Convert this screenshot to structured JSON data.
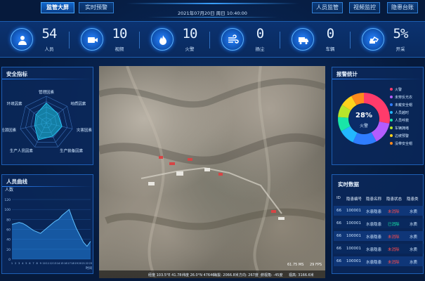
{
  "header": {
    "left_tabs": [
      {
        "label": "监管大屏",
        "active": true
      },
      {
        "label": "实时预警",
        "active": false
      }
    ],
    "datetime": "2021年07月20日  周日  10:40:00",
    "right_tabs": [
      {
        "label": "人员监管"
      },
      {
        "label": "视频监控"
      },
      {
        "label": "隐患台账"
      }
    ]
  },
  "stats": [
    {
      "value": "54",
      "label": "人员",
      "icon": "person-icon"
    },
    {
      "value": "10",
      "label": "视频",
      "icon": "video-icon"
    },
    {
      "value": "10",
      "label": "火警",
      "icon": "fire-icon"
    },
    {
      "value": "0",
      "label": "扬尘",
      "icon": "wind-icon"
    },
    {
      "value": "0",
      "label": "车辆",
      "icon": "truck-icon"
    },
    {
      "value": "5%",
      "label": "开采",
      "icon": "excavator-icon"
    }
  ],
  "safety_panel": {
    "title": "安全指标",
    "axes": [
      "管理因素",
      "地质因素",
      "灾害因素",
      "生产装备因素",
      "生产人员因素",
      "危险源因素",
      "环境因素"
    ],
    "radar_values": [
      0.75,
      0.55,
      0.6,
      0.55,
      0.7,
      0.45,
      0.5
    ]
  },
  "personnel_panel": {
    "title": "人员曲线",
    "unit": "人数",
    "x_unit": "时间",
    "y_ticks": [
      "120",
      "100",
      "80",
      "60",
      "40",
      "20",
      "0"
    ]
  },
  "chart_data": {
    "type": "area",
    "title": "人员曲线",
    "ylabel": "人数",
    "xlabel": "时间",
    "x": [
      "1",
      "2",
      "3",
      "4",
      "5",
      "6",
      "7",
      "8",
      "9",
      "10",
      "11",
      "12",
      "13",
      "14",
      "15",
      "16",
      "17",
      "18",
      "19",
      "20",
      "21",
      "22",
      "23"
    ],
    "values": [
      70,
      72,
      74,
      72,
      68,
      63,
      58,
      55,
      52,
      58,
      64,
      70,
      76,
      80,
      88,
      94,
      100,
      80,
      62,
      48,
      34,
      26,
      36
    ],
    "ylim": [
      0,
      120
    ]
  },
  "alarm_panel": {
    "title": "报警统计",
    "center_value": "28%",
    "center_label": "火警",
    "legend": [
      {
        "label": "火警",
        "color": "#ff3b6b",
        "value": 28
      },
      {
        "label": "未穿反光衣",
        "color": "#b35cff",
        "value": 14
      },
      {
        "label": "未戴安全帽",
        "color": "#2f7dff",
        "value": 15
      },
      {
        "label": "人员越时",
        "color": "#22b8ff",
        "value": 10
      },
      {
        "label": "人员呼救",
        "color": "#19e6a8",
        "value": 9
      },
      {
        "label": "车辆拥堵",
        "color": "#b8e62a",
        "value": 8
      },
      {
        "label": "边坡预警",
        "color": "#ffd21c",
        "value": 8
      },
      {
        "label": "没带安全帽",
        "color": "#ff8a1c",
        "value": 8
      }
    ]
  },
  "realtime_panel": {
    "title": "实时数据",
    "columns": [
      "ID",
      "隐患编号",
      "隐患名称",
      "隐患状态",
      "隐患类"
    ],
    "rows": [
      {
        "id": "66",
        "code": "100001",
        "name": "水患隐患",
        "status": "未消除",
        "status_color": "#ff4d4d",
        "type": "水质"
      },
      {
        "id": "66",
        "code": "100001",
        "name": "水患隐患",
        "status": "已消除",
        "status_color": "#19e6a8",
        "type": "水质"
      },
      {
        "id": "66",
        "code": "100001",
        "name": "水患隐患",
        "status": "未消除",
        "status_color": "#ff4d4d",
        "type": "水质"
      },
      {
        "id": "66",
        "code": "100001",
        "name": "水患隐患",
        "status": "未消除",
        "status_color": "#ff4d4d",
        "type": "水质"
      },
      {
        "id": "66",
        "code": "100001",
        "name": "水患隐患",
        "status": "未消除",
        "status_color": "#ff4d4d",
        "type": "水质"
      }
    ]
  },
  "map": {
    "bottom_info": [
      "经度 103.5°E 41.78",
      "纬度 26.0°N 47646",
      "海拔: 2066.8米",
      "方向: 267度",
      "俯视角: -45度",
      "视高: 3166.6米"
    ],
    "top_info": [
      "61.75 MS",
      "29 FPS"
    ]
  }
}
